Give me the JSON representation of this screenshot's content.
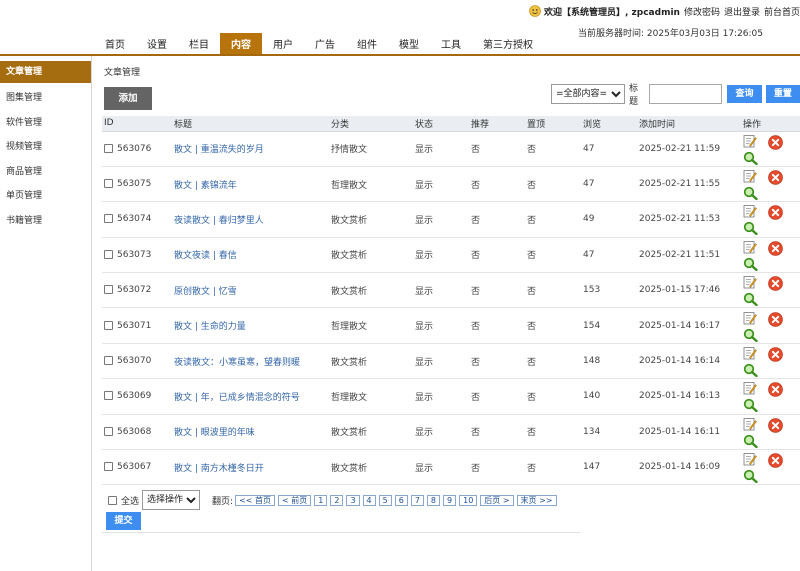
{
  "header": {
    "welcome_text": "欢迎【系统管理员】, zpcadmin",
    "links": [
      "修改密码",
      "退出登录",
      "前台首页"
    ],
    "server_time_label": "当前服务器时间:",
    "server_time": "2025年03月03日 17:26:05"
  },
  "nav": {
    "items": [
      {
        "label": "首页",
        "active": false
      },
      {
        "label": "设置",
        "active": false
      },
      {
        "label": "栏目",
        "active": false
      },
      {
        "label": "内容",
        "active": true
      },
      {
        "label": "用户",
        "active": false
      },
      {
        "label": "广告",
        "active": false
      },
      {
        "label": "组件",
        "active": false
      },
      {
        "label": "模型",
        "active": false
      },
      {
        "label": "工具",
        "active": false
      },
      {
        "label": "第三方授权",
        "active": false
      }
    ]
  },
  "sidebar": {
    "items": [
      {
        "label": "文章管理",
        "active": true
      },
      {
        "label": "图集管理",
        "active": false
      },
      {
        "label": "软件管理",
        "active": false
      },
      {
        "label": "视频管理",
        "active": false
      },
      {
        "label": "商品管理",
        "active": false
      },
      {
        "label": "单页管理",
        "active": false
      },
      {
        "label": "书籍管理",
        "active": false
      }
    ]
  },
  "main": {
    "title": "文章管理",
    "add_label": "添加",
    "filter": {
      "select_value": "=全部内容=",
      "title_label": "标题",
      "search_value": "",
      "search_label": "查询",
      "reset_label": "重置"
    },
    "columns": [
      "ID",
      "标题",
      "分类",
      "状态",
      "推荐",
      "置顶",
      "浏览",
      "添加时间",
      "操作"
    ],
    "rows": [
      {
        "id": "563076",
        "title": "散文 | 重温流失的岁月",
        "category": "抒情散文",
        "status": "显示",
        "recommend": "否",
        "top": "否",
        "views": "47",
        "time": "2025-02-21 11:59"
      },
      {
        "id": "563075",
        "title": "散文 | 素锦流年",
        "category": "哲理散文",
        "status": "显示",
        "recommend": "否",
        "top": "否",
        "views": "47",
        "time": "2025-02-21 11:55"
      },
      {
        "id": "563074",
        "title": "夜读散文 | 春归梦里人",
        "category": "散文赏析",
        "status": "显示",
        "recommend": "否",
        "top": "否",
        "views": "49",
        "time": "2025-02-21 11:53"
      },
      {
        "id": "563073",
        "title": "散文夜读 | 春信",
        "category": "散文赏析",
        "status": "显示",
        "recommend": "否",
        "top": "否",
        "views": "47",
        "time": "2025-02-21 11:51"
      },
      {
        "id": "563072",
        "title": "原创散文 | 忆雪",
        "category": "散文赏析",
        "status": "显示",
        "recommend": "否",
        "top": "否",
        "views": "153",
        "time": "2025-01-15 17:46"
      },
      {
        "id": "563071",
        "title": "散文 | 生命的力量",
        "category": "哲理散文",
        "status": "显示",
        "recommend": "否",
        "top": "否",
        "views": "154",
        "time": "2025-01-14 16:17"
      },
      {
        "id": "563070",
        "title": "夜读散文：小寒虽寒，望春则暖",
        "category": "散文赏析",
        "status": "显示",
        "recommend": "否",
        "top": "否",
        "views": "148",
        "time": "2025-01-14 16:14"
      },
      {
        "id": "563069",
        "title": "散文 | 年，已成乡情混念的符号",
        "category": "哲理散文",
        "status": "显示",
        "recommend": "否",
        "top": "否",
        "views": "140",
        "time": "2025-01-14 16:13"
      },
      {
        "id": "563068",
        "title": "散文 | 眼波里的年味",
        "category": "散文赏析",
        "status": "显示",
        "recommend": "否",
        "top": "否",
        "views": "134",
        "time": "2025-01-14 16:11"
      },
      {
        "id": "563067",
        "title": "散文 | 南方木槿冬日开",
        "category": "散文赏析",
        "status": "显示",
        "recommend": "否",
        "top": "否",
        "views": "147",
        "time": "2025-01-14 16:09"
      }
    ],
    "footer": {
      "select_all_label": "全选",
      "action_select_value": "选择操作",
      "page_label": "翻页:",
      "pager": [
        "<< 首页",
        "< 前页",
        "1",
        "2",
        "3",
        "4",
        "5",
        "6",
        "7",
        "8",
        "9",
        "10",
        "后页 >",
        "末页 >>"
      ],
      "submit_label": "提交"
    }
  },
  "colors": {
    "nav_active": "#b8740c",
    "sidebar_active": "#a66c10",
    "button_blue": "#3d8ef0",
    "link_blue": "#3366aa",
    "add_button": "#646464"
  }
}
